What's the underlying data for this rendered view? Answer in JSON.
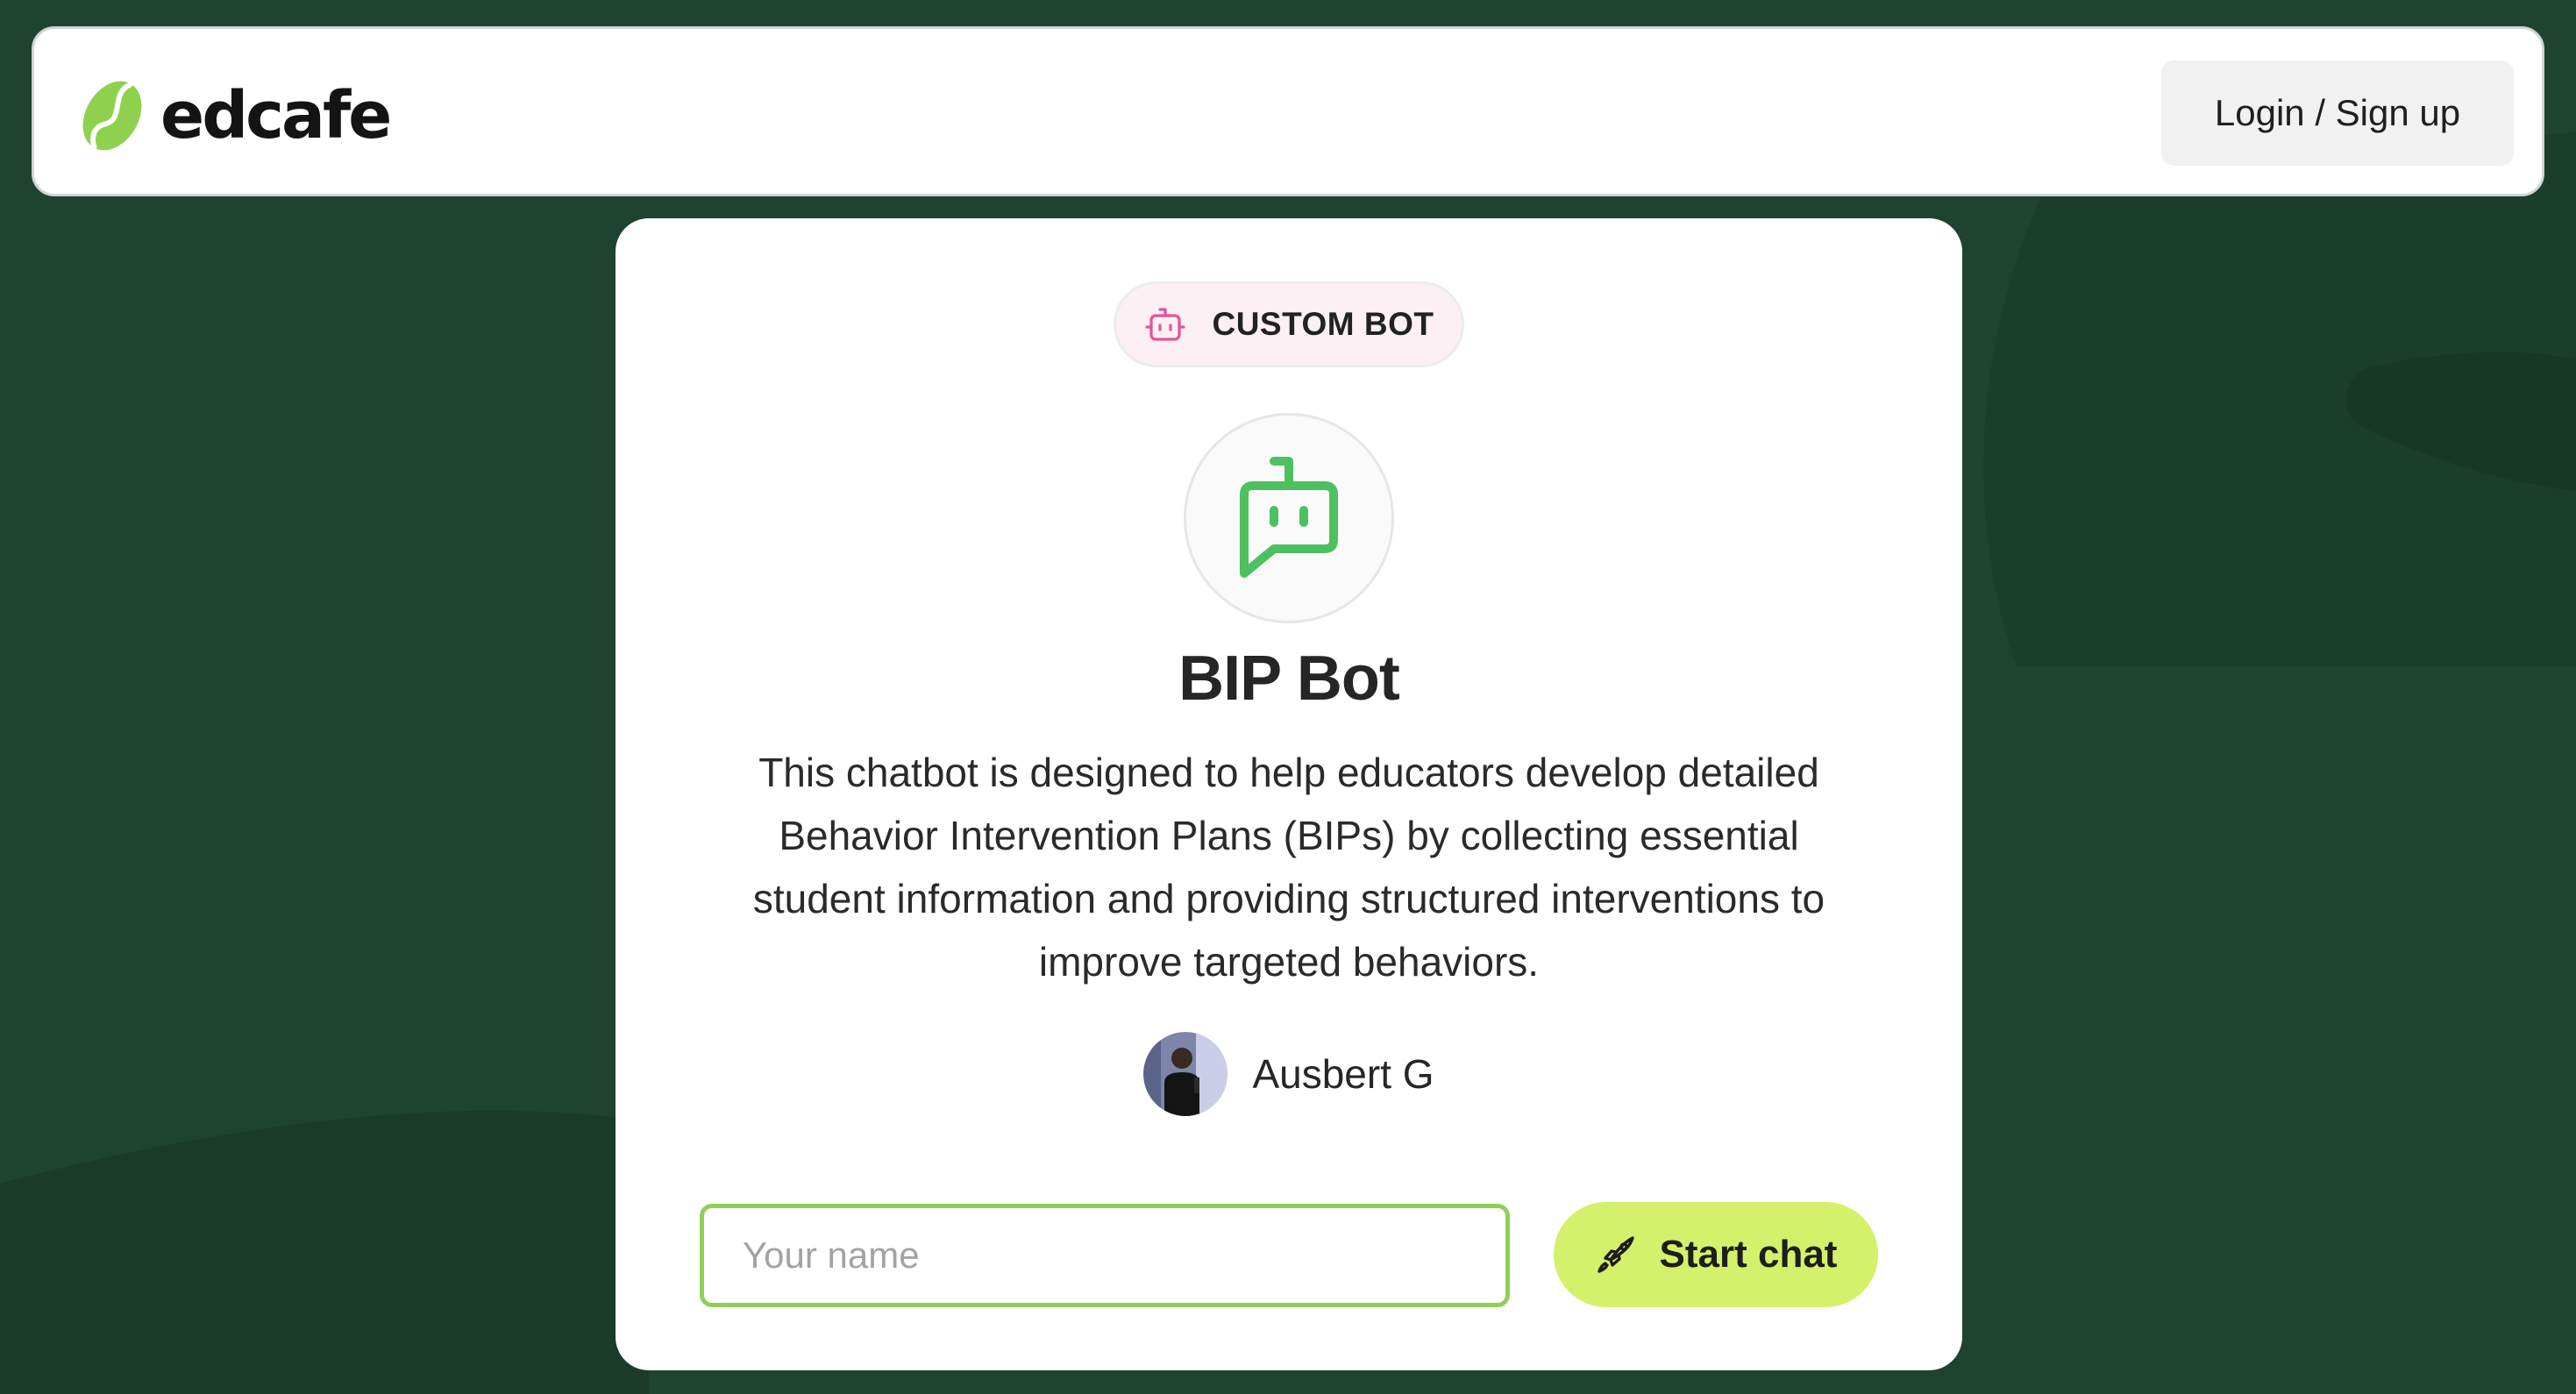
{
  "app": {
    "brand": "edcafe",
    "brand_color": "#8fd14f",
    "background_color": "#1e4331",
    "accent_color": "#d5f06a"
  },
  "header": {
    "login_label": "Login / Sign up"
  },
  "card": {
    "badge": {
      "icon": "robot-icon",
      "label": "CUSTOM BOT"
    },
    "bot_icon": "chat-bot-icon",
    "bot_name": "BIP Bot",
    "description": "This chatbot is designed to help educators develop detailed Behavior Intervention Plans (BIPs) by collecting essential student information and providing structured interventions to improve targeted behaviors.",
    "author": {
      "name": "Ausbert G"
    },
    "name_input": {
      "value": "",
      "placeholder": "Your name"
    },
    "start_button": {
      "icon": "rocket-icon",
      "label": "Start chat"
    }
  }
}
